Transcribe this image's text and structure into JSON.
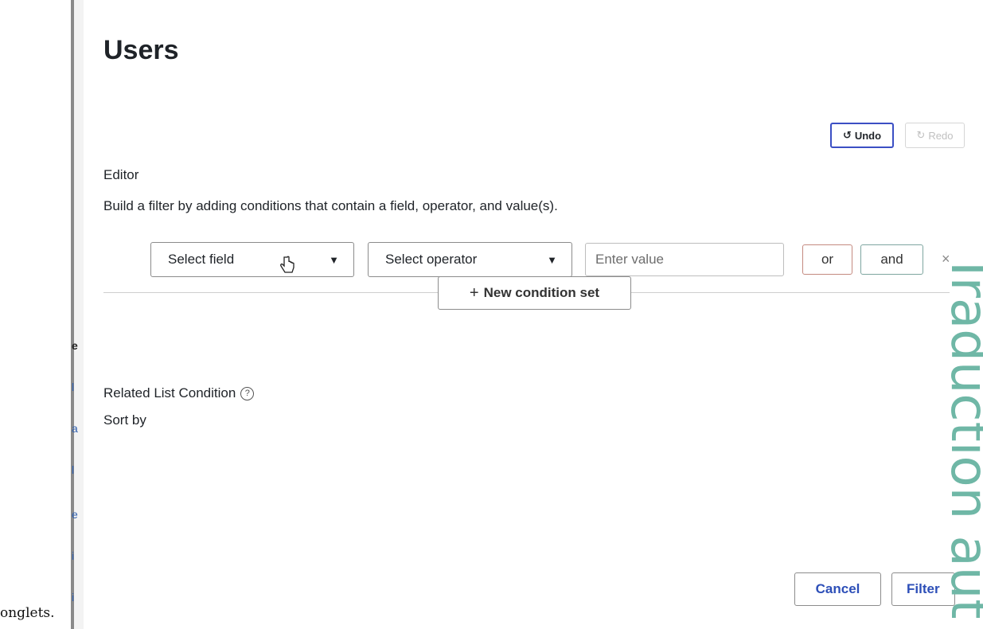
{
  "page": {
    "title": "Users"
  },
  "background": {
    "left_word": "onglets."
  },
  "history": {
    "undo_label": "Undo",
    "redo_label": "Redo"
  },
  "editor": {
    "label": "Editor",
    "help": "Build a filter by adding conditions that contain a field, operator, and value(s)."
  },
  "condition": {
    "field_select": "Select field",
    "operator_select": "Select operator",
    "value_placeholder": "Enter value",
    "or_label": "or",
    "and_label": "and",
    "remove_glyph": "×"
  },
  "new_condition_set_label": "New condition set",
  "related_list_label": "Related List Condition",
  "sort_by_label": "Sort by",
  "footer": {
    "cancel_label": "Cancel",
    "filter_label": "Filter"
  },
  "watermark": "Traduction aut",
  "colors": {
    "undo_border": "#3b4fc4",
    "primary_text": "#2d4fb8",
    "watermark": "#6fb7a6",
    "or_border": "#c48a80",
    "and_border": "#7ea6a0"
  }
}
